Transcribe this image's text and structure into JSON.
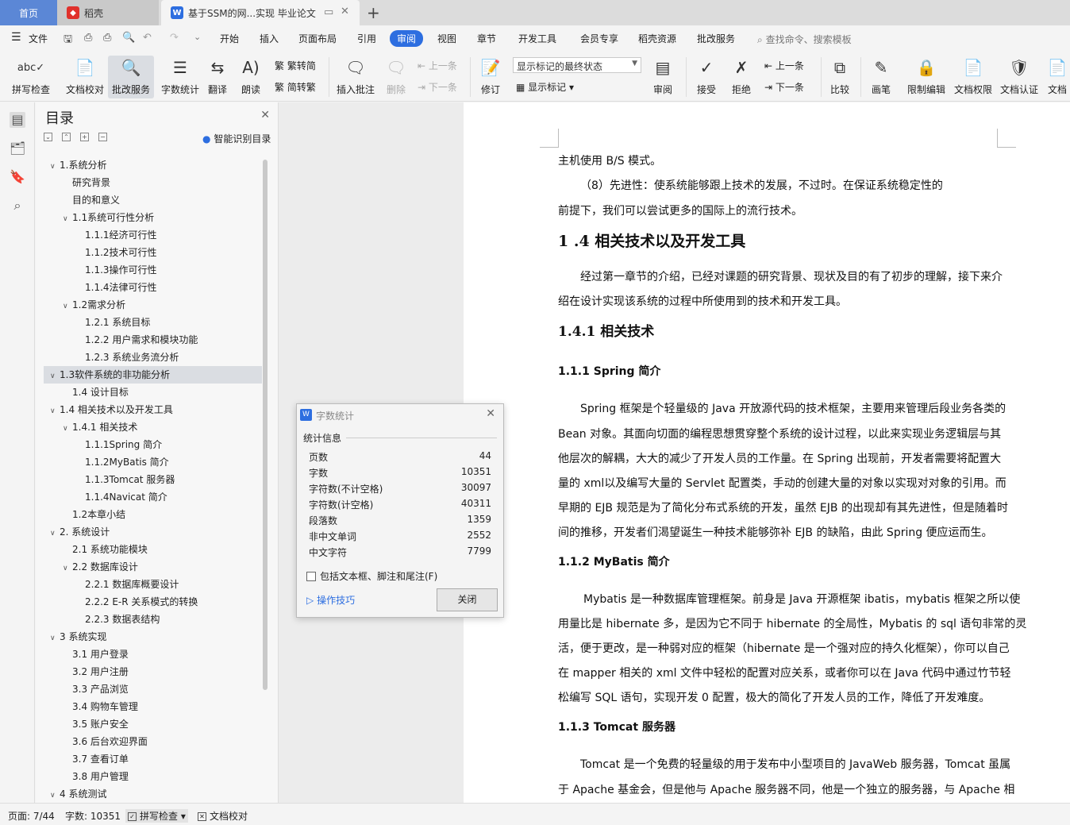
{
  "tabs": {
    "home": "首页",
    "daoke": "稻壳",
    "doc": "基于SSM的网...实现 毕业论文"
  },
  "menu": {
    "file": "文件",
    "items": [
      "开始",
      "插入",
      "页面布局",
      "引用",
      "审阅",
      "视图",
      "章节",
      "开发工具",
      "会员专享",
      "稻壳资源",
      "批改服务"
    ],
    "search": "查找命令、搜索模板"
  },
  "ribbon": {
    "spell": "拼写检查",
    "proof": "文档校对",
    "correct": "批改服务",
    "wordcount": "字数统计",
    "translate": "翻译",
    "read": "朗读",
    "trad": "繁转简",
    "simp": "简转繁",
    "insert_comment": "插入批注",
    "delete": "删除",
    "prev": "上一条",
    "next": "下一条",
    "revise": "修订",
    "mark_select": "显示标记的最终状态",
    "show_marks": "显示标记",
    "review": "审阅",
    "accept": "接受",
    "reject": "拒绝",
    "prev2": "上一条",
    "next2": "下一条",
    "compare": "比较",
    "pen": "画笔",
    "restrict": "限制编辑",
    "perm": "文档权限",
    "cert": "文档认证",
    "more": "文档"
  },
  "toc": {
    "title": "目录",
    "smart": "智能识别目录",
    "items": [
      {
        "t": "1.系统分析",
        "lv": 0,
        "arr": true
      },
      {
        "t": "研究背景",
        "lv": 1,
        "arr": false
      },
      {
        "t": "目的和意义",
        "lv": 1,
        "arr": false
      },
      {
        "t": "1.1系统可行性分析",
        "lv": 1,
        "arr": true
      },
      {
        "t": "1.1.1经济可行性",
        "lv": 2,
        "arr": false
      },
      {
        "t": "1.1.2技术可行性",
        "lv": 2,
        "arr": false
      },
      {
        "t": "1.1.3操作可行性",
        "lv": 2,
        "arr": false
      },
      {
        "t": "1.1.4法律可行性",
        "lv": 2,
        "arr": false
      },
      {
        "t": "1.2需求分析",
        "lv": 1,
        "arr": true
      },
      {
        "t": "1.2.1  系统目标",
        "lv": 2,
        "arr": false
      },
      {
        "t": "1.2.2  用户需求和模块功能",
        "lv": 2,
        "arr": false
      },
      {
        "t": "1.2.3  系统业务流分析",
        "lv": 2,
        "arr": false
      },
      {
        "t": "1.3软件系统的非功能分析",
        "lv": 0,
        "arr": true,
        "hl": true
      },
      {
        "t": "1.4  设计目标",
        "lv": 1,
        "arr": false
      },
      {
        "t": "1.4 相关技术以及开发工具",
        "lv": 0,
        "arr": true
      },
      {
        "t": "1.4.1 相关技术",
        "lv": 1,
        "arr": true
      },
      {
        "t": "1.1.1Spring 简介",
        "lv": 2,
        "arr": false
      },
      {
        "t": "1.1.2MyBatis 简介",
        "lv": 2,
        "arr": false
      },
      {
        "t": "1.1.3Tomcat 服务器",
        "lv": 2,
        "arr": false
      },
      {
        "t": "1.1.4Navicat 简介",
        "lv": 2,
        "arr": false
      },
      {
        "t": "1.2本章小结",
        "lv": 1,
        "arr": false
      },
      {
        "t": "2. 系统设计",
        "lv": 0,
        "arr": true
      },
      {
        "t": "2.1  系统功能模块",
        "lv": 1,
        "arr": false
      },
      {
        "t": "2.2  数据库设计",
        "lv": 1,
        "arr": true
      },
      {
        "t": "2.2.1  数据库概要设计",
        "lv": 2,
        "arr": false
      },
      {
        "t": "2.2.2 E-R 关系模式的转换",
        "lv": 2,
        "arr": false
      },
      {
        "t": "2.2.3  数据表结构",
        "lv": 2,
        "arr": false
      },
      {
        "t": "3  系统实现",
        "lv": 0,
        "arr": true
      },
      {
        "t": "3.1  用户登录",
        "lv": 1,
        "arr": false
      },
      {
        "t": "3.2  用户注册",
        "lv": 1,
        "arr": false
      },
      {
        "t": "3.3 产品浏览",
        "lv": 1,
        "arr": false
      },
      {
        "t": "3.4  购物车管理",
        "lv": 1,
        "arr": false
      },
      {
        "t": "3.5  账户安全",
        "lv": 1,
        "arr": false
      },
      {
        "t": "3.6  后台欢迎界面",
        "lv": 1,
        "arr": false
      },
      {
        "t": "3.7  查看订单",
        "lv": 1,
        "arr": false
      },
      {
        "t": "3.8  用户管理",
        "lv": 1,
        "arr": false
      },
      {
        "t": "4  系统测试",
        "lv": 0,
        "arr": true
      }
    ]
  },
  "doc": {
    "l1": "主机使用 B/S 模式。",
    "l2": "（8）先进性：使系统能够跟上技术的发展，不过时。在保证系统稳定性的",
    "l3": "前提下，我们可以尝试更多的国际上的流行技术。",
    "h14": "1   .4 相关技术以及开发工具",
    "p1a": "经过第一章节的介绍，已经对课题的研究背景、现状及目的有了初步的理解，接下来介",
    "p1b": "绍在设计实现该系统的过程中所使用到的技术和开发工具。",
    "h141": "1.4.1 相关技术",
    "h111": "1.1.1     Spring 简介",
    "s1": "Spring 框架是个轻量级的 Java 开放源代码的技术框架，主要用来管理后段业务各类的",
    "s2": "Bean 对象。其面向切面的编程思想贯穿整个系统的设计过程，以此来实现业务逻辑层与其",
    "s3": "他层次的解耦，大大的减少了开发人员的工作量。在 Spring 出现前，开发者需要将配置大",
    "s4": "量的 xml以及编写大量的 Servlet 配置类，手动的创建大量的对象以实现对对象的引用。而",
    "s5": "早期的 EJB 规范是为了简化分布式系统的开发，虽然 EJB 的出现却有其先进性，但是随着时",
    "s6": "间的推移，开发者们渴望诞生一种技术能够弥补 EJB 的缺陷，由此 Spring 便应运而生。",
    "h112": "1.1.2     MyBatis 简介",
    "m1": "Mybatis 是一种数据库管理框架。前身是 Java 开源框架 ibatis，mybatis 框架之所以使",
    "m2": "用量比是 hibernate 多，是因为它不同于 hibernate 的全局性，Mybatis 的 sql 语句非常的灵",
    "m3": "活，便于更改，是一种弱对应的框架（hibernate 是一个强对应的持久化框架），你可以自己",
    "m4": "在 mapper 相关的 xml 文件中轻松的配置对应关系，或者你可以在 Java 代码中通过竹节轻",
    "m5": "松编写 SQL 语句，实现开发 0 配置，极大的简化了开发人员的工作，降低了开发难度。",
    "h113": "1.1.3     Tomcat 服务器",
    "t1": "Tomcat 是一个免费的轻量级的用于发布中小型项目的 JavaWeb 服务器，Tomcat 虽属",
    "t2": "于 Apache 基金会，但是他与 Apache 服务器不同，他是一个独立的服务器，与 Apache 相"
  },
  "dialog": {
    "title": "字数统计",
    "section": "统计信息",
    "rows": [
      {
        "k": "页数",
        "v": "44"
      },
      {
        "k": "字数",
        "v": "10351"
      },
      {
        "k": "字符数(不计空格)",
        "v": "30097"
      },
      {
        "k": "字符数(计空格)",
        "v": "40311"
      },
      {
        "k": "段落数",
        "v": "1359"
      },
      {
        "k": "非中文单词",
        "v": "2552"
      },
      {
        "k": "中文字符",
        "v": "7799"
      }
    ],
    "include": "包括文本框、脚注和尾注(F)",
    "tips": "操作技巧",
    "close": "关闭"
  },
  "status": {
    "page": "页面: 7/44",
    "words": "字数: 10351",
    "spell": "拼写检查",
    "proof": "文档校对"
  }
}
